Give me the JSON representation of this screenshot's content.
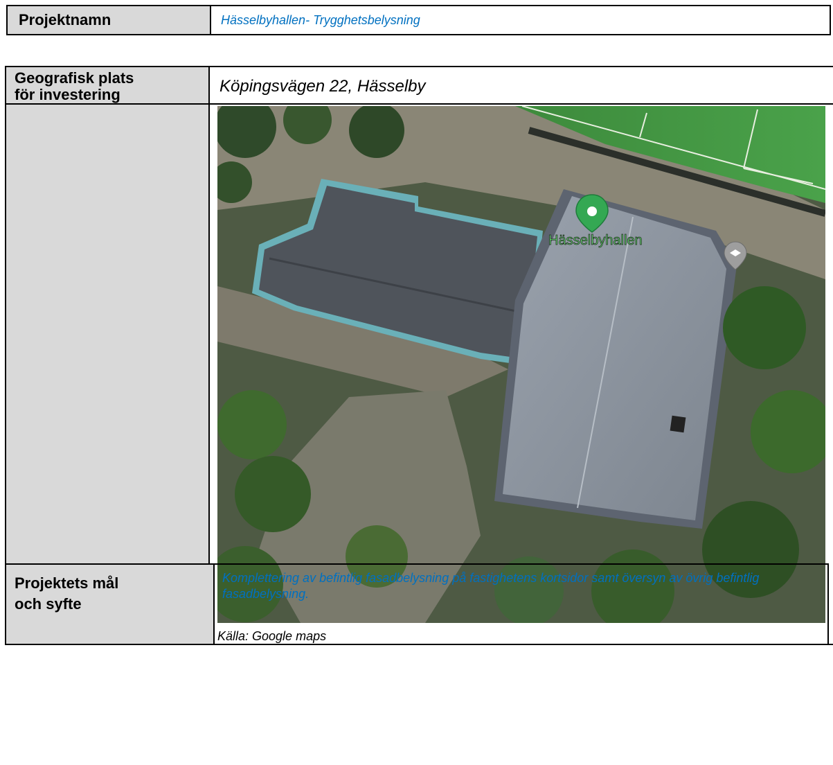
{
  "project_name": {
    "label": "Projektnamn",
    "value": "Hässelbyhallen- Trygghetsbelysning"
  },
  "location": {
    "label_line1": "Geografisk plats",
    "label_line2": "för investering",
    "address": "Köpingsvägen 22, Hässelby",
    "map": {
      "place_label": "Hässelbyhallen",
      "pin_icon": "map-pin-icon",
      "school_icon": "school-pin-icon",
      "pin_color": "#34a853"
    },
    "caption": "Källa: Google maps"
  },
  "goals": {
    "label_line1": "Projektets mål",
    "label_line2": "och syfte",
    "text": "Komplettering av befintlig fasadbelysning på fastighetens kortsidor samt översyn av övrig befintlig fasadbelysning."
  }
}
